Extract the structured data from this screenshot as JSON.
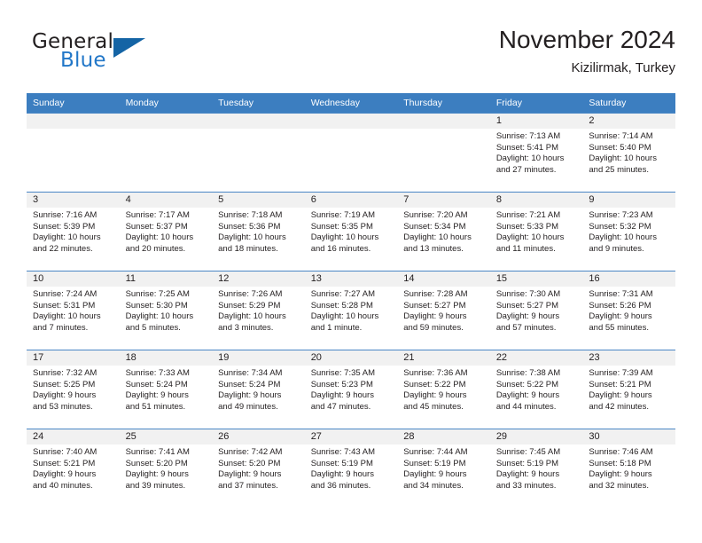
{
  "brand": {
    "name_part1": "General",
    "name_part2": "Blue",
    "logo_icon": "triangle-logo-icon"
  },
  "header": {
    "title": "November 2024",
    "location": "Kizilirmak, Turkey"
  },
  "colors": {
    "header_blue": "#3c7ec0",
    "brand_blue": "#2277c8",
    "logo_blue": "#1464a5",
    "daynum_band": "#f1f1f1",
    "text": "#231f20"
  },
  "weekday_headers": [
    "Sunday",
    "Monday",
    "Tuesday",
    "Wednesday",
    "Thursday",
    "Friday",
    "Saturday"
  ],
  "weeks": [
    [
      {
        "day": "",
        "blank": true,
        "sunrise": "",
        "sunset": "",
        "daylight_line1": "",
        "daylight_line2": ""
      },
      {
        "day": "",
        "blank": true,
        "sunrise": "",
        "sunset": "",
        "daylight_line1": "",
        "daylight_line2": ""
      },
      {
        "day": "",
        "blank": true,
        "sunrise": "",
        "sunset": "",
        "daylight_line1": "",
        "daylight_line2": ""
      },
      {
        "day": "",
        "blank": true,
        "sunrise": "",
        "sunset": "",
        "daylight_line1": "",
        "daylight_line2": ""
      },
      {
        "day": "",
        "blank": true,
        "sunrise": "",
        "sunset": "",
        "daylight_line1": "",
        "daylight_line2": ""
      },
      {
        "day": "1",
        "blank": false,
        "sunrise": "Sunrise: 7:13 AM",
        "sunset": "Sunset: 5:41 PM",
        "daylight_line1": "Daylight: 10 hours",
        "daylight_line2": "and 27 minutes."
      },
      {
        "day": "2",
        "blank": false,
        "sunrise": "Sunrise: 7:14 AM",
        "sunset": "Sunset: 5:40 PM",
        "daylight_line1": "Daylight: 10 hours",
        "daylight_line2": "and 25 minutes."
      }
    ],
    [
      {
        "day": "3",
        "blank": false,
        "sunrise": "Sunrise: 7:16 AM",
        "sunset": "Sunset: 5:39 PM",
        "daylight_line1": "Daylight: 10 hours",
        "daylight_line2": "and 22 minutes."
      },
      {
        "day": "4",
        "blank": false,
        "sunrise": "Sunrise: 7:17 AM",
        "sunset": "Sunset: 5:37 PM",
        "daylight_line1": "Daylight: 10 hours",
        "daylight_line2": "and 20 minutes."
      },
      {
        "day": "5",
        "blank": false,
        "sunrise": "Sunrise: 7:18 AM",
        "sunset": "Sunset: 5:36 PM",
        "daylight_line1": "Daylight: 10 hours",
        "daylight_line2": "and 18 minutes."
      },
      {
        "day": "6",
        "blank": false,
        "sunrise": "Sunrise: 7:19 AM",
        "sunset": "Sunset: 5:35 PM",
        "daylight_line1": "Daylight: 10 hours",
        "daylight_line2": "and 16 minutes."
      },
      {
        "day": "7",
        "blank": false,
        "sunrise": "Sunrise: 7:20 AM",
        "sunset": "Sunset: 5:34 PM",
        "daylight_line1": "Daylight: 10 hours",
        "daylight_line2": "and 13 minutes."
      },
      {
        "day": "8",
        "blank": false,
        "sunrise": "Sunrise: 7:21 AM",
        "sunset": "Sunset: 5:33 PM",
        "daylight_line1": "Daylight: 10 hours",
        "daylight_line2": "and 11 minutes."
      },
      {
        "day": "9",
        "blank": false,
        "sunrise": "Sunrise: 7:23 AM",
        "sunset": "Sunset: 5:32 PM",
        "daylight_line1": "Daylight: 10 hours",
        "daylight_line2": "and 9 minutes."
      }
    ],
    [
      {
        "day": "10",
        "blank": false,
        "sunrise": "Sunrise: 7:24 AM",
        "sunset": "Sunset: 5:31 PM",
        "daylight_line1": "Daylight: 10 hours",
        "daylight_line2": "and 7 minutes."
      },
      {
        "day": "11",
        "blank": false,
        "sunrise": "Sunrise: 7:25 AM",
        "sunset": "Sunset: 5:30 PM",
        "daylight_line1": "Daylight: 10 hours",
        "daylight_line2": "and 5 minutes."
      },
      {
        "day": "12",
        "blank": false,
        "sunrise": "Sunrise: 7:26 AM",
        "sunset": "Sunset: 5:29 PM",
        "daylight_line1": "Daylight: 10 hours",
        "daylight_line2": "and 3 minutes."
      },
      {
        "day": "13",
        "blank": false,
        "sunrise": "Sunrise: 7:27 AM",
        "sunset": "Sunset: 5:28 PM",
        "daylight_line1": "Daylight: 10 hours",
        "daylight_line2": "and 1 minute."
      },
      {
        "day": "14",
        "blank": false,
        "sunrise": "Sunrise: 7:28 AM",
        "sunset": "Sunset: 5:27 PM",
        "daylight_line1": "Daylight: 9 hours",
        "daylight_line2": "and 59 minutes."
      },
      {
        "day": "15",
        "blank": false,
        "sunrise": "Sunrise: 7:30 AM",
        "sunset": "Sunset: 5:27 PM",
        "daylight_line1": "Daylight: 9 hours",
        "daylight_line2": "and 57 minutes."
      },
      {
        "day": "16",
        "blank": false,
        "sunrise": "Sunrise: 7:31 AM",
        "sunset": "Sunset: 5:26 PM",
        "daylight_line1": "Daylight: 9 hours",
        "daylight_line2": "and 55 minutes."
      }
    ],
    [
      {
        "day": "17",
        "blank": false,
        "sunrise": "Sunrise: 7:32 AM",
        "sunset": "Sunset: 5:25 PM",
        "daylight_line1": "Daylight: 9 hours",
        "daylight_line2": "and 53 minutes."
      },
      {
        "day": "18",
        "blank": false,
        "sunrise": "Sunrise: 7:33 AM",
        "sunset": "Sunset: 5:24 PM",
        "daylight_line1": "Daylight: 9 hours",
        "daylight_line2": "and 51 minutes."
      },
      {
        "day": "19",
        "blank": false,
        "sunrise": "Sunrise: 7:34 AM",
        "sunset": "Sunset: 5:24 PM",
        "daylight_line1": "Daylight: 9 hours",
        "daylight_line2": "and 49 minutes."
      },
      {
        "day": "20",
        "blank": false,
        "sunrise": "Sunrise: 7:35 AM",
        "sunset": "Sunset: 5:23 PM",
        "daylight_line1": "Daylight: 9 hours",
        "daylight_line2": "and 47 minutes."
      },
      {
        "day": "21",
        "blank": false,
        "sunrise": "Sunrise: 7:36 AM",
        "sunset": "Sunset: 5:22 PM",
        "daylight_line1": "Daylight: 9 hours",
        "daylight_line2": "and 45 minutes."
      },
      {
        "day": "22",
        "blank": false,
        "sunrise": "Sunrise: 7:38 AM",
        "sunset": "Sunset: 5:22 PM",
        "daylight_line1": "Daylight: 9 hours",
        "daylight_line2": "and 44 minutes."
      },
      {
        "day": "23",
        "blank": false,
        "sunrise": "Sunrise: 7:39 AM",
        "sunset": "Sunset: 5:21 PM",
        "daylight_line1": "Daylight: 9 hours",
        "daylight_line2": "and 42 minutes."
      }
    ],
    [
      {
        "day": "24",
        "blank": false,
        "sunrise": "Sunrise: 7:40 AM",
        "sunset": "Sunset: 5:21 PM",
        "daylight_line1": "Daylight: 9 hours",
        "daylight_line2": "and 40 minutes."
      },
      {
        "day": "25",
        "blank": false,
        "sunrise": "Sunrise: 7:41 AM",
        "sunset": "Sunset: 5:20 PM",
        "daylight_line1": "Daylight: 9 hours",
        "daylight_line2": "and 39 minutes."
      },
      {
        "day": "26",
        "blank": false,
        "sunrise": "Sunrise: 7:42 AM",
        "sunset": "Sunset: 5:20 PM",
        "daylight_line1": "Daylight: 9 hours",
        "daylight_line2": "and 37 minutes."
      },
      {
        "day": "27",
        "blank": false,
        "sunrise": "Sunrise: 7:43 AM",
        "sunset": "Sunset: 5:19 PM",
        "daylight_line1": "Daylight: 9 hours",
        "daylight_line2": "and 36 minutes."
      },
      {
        "day": "28",
        "blank": false,
        "sunrise": "Sunrise: 7:44 AM",
        "sunset": "Sunset: 5:19 PM",
        "daylight_line1": "Daylight: 9 hours",
        "daylight_line2": "and 34 minutes."
      },
      {
        "day": "29",
        "blank": false,
        "sunrise": "Sunrise: 7:45 AM",
        "sunset": "Sunset: 5:19 PM",
        "daylight_line1": "Daylight: 9 hours",
        "daylight_line2": "and 33 minutes."
      },
      {
        "day": "30",
        "blank": false,
        "sunrise": "Sunrise: 7:46 AM",
        "sunset": "Sunset: 5:18 PM",
        "daylight_line1": "Daylight: 9 hours",
        "daylight_line2": "and 32 minutes."
      }
    ]
  ]
}
